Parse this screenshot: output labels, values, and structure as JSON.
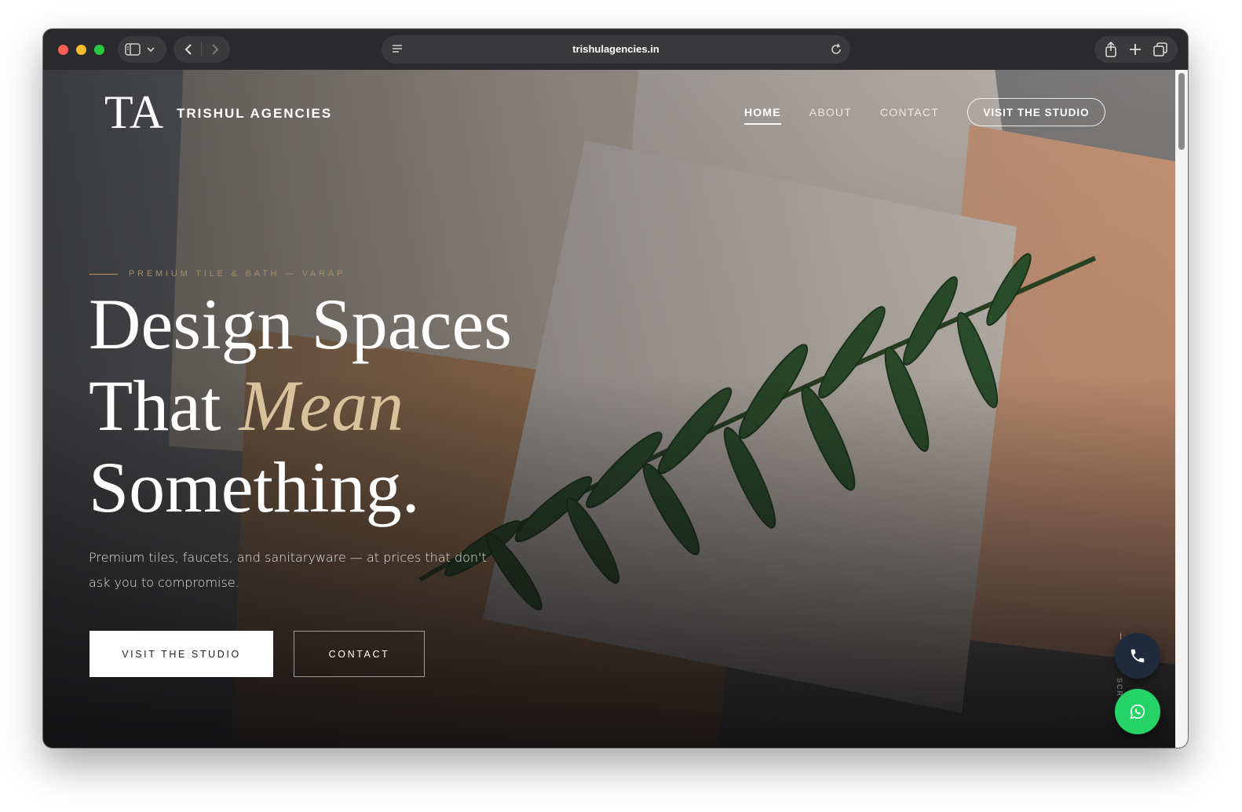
{
  "browser": {
    "url": "trishulagencies.in"
  },
  "site": {
    "logo_mark": "TA",
    "brand_name": "TRISHUL AGENCIES",
    "nav": [
      {
        "label": "HOME",
        "active": true
      },
      {
        "label": "ABOUT",
        "active": false
      },
      {
        "label": "CONTACT",
        "active": false
      }
    ],
    "nav_cta": "VISIT THE STUDIO"
  },
  "hero": {
    "eyebrow": "PREMIUM TILE & BATH — VARAP",
    "headline_line1": "Design Spaces",
    "headline_line2_pre": "That ",
    "headline_line2_accent": "Mean",
    "headline_line3": "Something.",
    "subtext": "Premium tiles, faucets, and sanitaryware — at prices that don't ask you to compromise.",
    "primary_button": "VISIT THE STUDIO",
    "secondary_button": "CONTACT",
    "scroll_hint": "SCR"
  },
  "floating": {
    "phone_icon": "phone-icon",
    "whatsapp_icon": "whatsapp-icon"
  },
  "colors": {
    "accent_gold": "#d9c19b",
    "whatsapp_green": "#25d366",
    "phone_navy": "#1f2a3d"
  }
}
